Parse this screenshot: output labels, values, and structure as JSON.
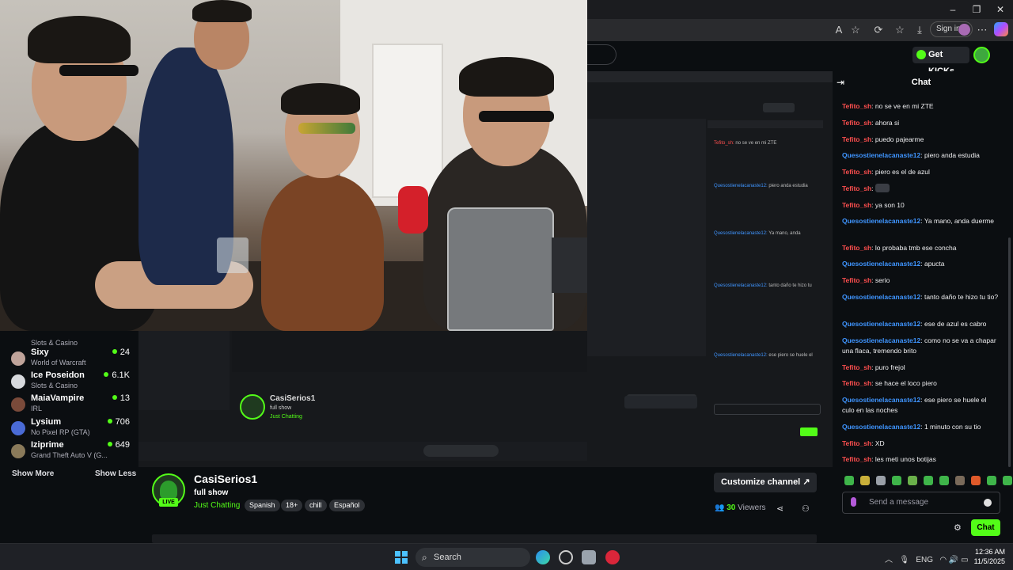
{
  "browser": {
    "signin_label": "Sign in",
    "window_controls": [
      "–",
      "❐",
      "✕"
    ],
    "toolbar_icons": [
      "read-aloud-icon",
      "favorite-star-icon",
      "extensions-icon",
      "favorites-icon",
      "downloads-icon"
    ]
  },
  "header": {
    "get_kicks_label": "Get KICKs"
  },
  "sidebar": {
    "partial_top": {
      "name": "",
      "category": "Slots & Casino"
    },
    "items": [
      {
        "name": "Sixy",
        "category": "World of Warcraft",
        "viewers": "24",
        "avatar_color": "#bfa39a"
      },
      {
        "name": "Ice Poseidon",
        "category": "Slots & Casino",
        "viewers": "6.1K",
        "avatar_color": "#d7d9dd"
      },
      {
        "name": "MaiaVampire",
        "category": "IRL",
        "viewers": "13",
        "avatar_color": "#7a4a3a"
      },
      {
        "name": "Lysium",
        "category": "No Pixel RP (GTA)",
        "viewers": "706",
        "avatar_color": "#4a6bd6"
      },
      {
        "name": "Iziprime",
        "category": "Grand Theft Auto V (G...",
        "viewers": "649",
        "avatar_color": "#8a7a5a"
      }
    ],
    "show_more": "Show More",
    "show_less": "Show Less"
  },
  "channel": {
    "name": "CasiSerios1",
    "live_badge": "LIVE",
    "title": "full show",
    "category": "Just Chatting",
    "tags": [
      "Spanish",
      "18+",
      "chill",
      "Español"
    ],
    "customize_label": "Customize channel",
    "viewers_count": "30",
    "viewers_label": "Viewers"
  },
  "chat": {
    "title": "Chat",
    "messages": [
      {
        "user": "Tefito_sh",
        "color": "red",
        "text": "no se ve en mi ZTE"
      },
      {
        "user": "Tefito_sh",
        "color": "red",
        "text": "ahora si"
      },
      {
        "user": "Tefito_sh",
        "color": "red",
        "text": "puedo pajearme"
      },
      {
        "user": "Quesostienelacanaste12",
        "color": "blue",
        "text": "piero anda estudia"
      },
      {
        "user": "Tefito_sh",
        "color": "red",
        "text": "piero es el de azul"
      },
      {
        "user": "Tefito_sh",
        "color": "red",
        "text": ""
      },
      {
        "user": "Tefito_sh",
        "color": "red",
        "text": "ya son 10"
      },
      {
        "user": "Quesostienelacanaste12",
        "color": "blue",
        "text": "Ya mano, anda duerme"
      },
      {
        "user": "Tefito_sh",
        "color": "red",
        "text": "lo probaba tmb ese concha"
      },
      {
        "user": "Quesostienelacanaste12",
        "color": "blue",
        "text": "apucta"
      },
      {
        "user": "Tefito_sh",
        "color": "red",
        "text": "serio"
      },
      {
        "user": "Quesostienelacanaste12",
        "color": "blue",
        "text": "tanto daño te hizo tu tio?"
      },
      {
        "user": "Quesostienelacanaste12",
        "color": "blue",
        "text": "ese de azul es cabro"
      },
      {
        "user": "Quesostienelacanaste12",
        "color": "blue",
        "text": "como no se va a chapar una flaca, tremendo brito"
      },
      {
        "user": "Tefito_sh",
        "color": "red",
        "text": "puro frejol"
      },
      {
        "user": "Tefito_sh",
        "color": "red",
        "text": "se hace el loco piero"
      },
      {
        "user": "Quesostienelacanaste12",
        "color": "blue",
        "text": "ese piero se huele el culo en las noches"
      },
      {
        "user": "Quesostienelacanaste12",
        "color": "blue",
        "text": "1 minuto con su tio"
      },
      {
        "user": "Tefito_sh",
        "color": "red",
        "text": "XD"
      },
      {
        "user": "Tefito_sh",
        "color": "red",
        "text": "les meti unos botijas"
      }
    ],
    "input_placeholder": "Send a message",
    "send_label": "Chat"
  },
  "taskbar": {
    "search_label": "Search",
    "language": "ENG",
    "time": "12:36 AM",
    "date": "11/5/2025"
  },
  "colors": {
    "kick_green": "#53fc18",
    "user_red": "#ff4f4f",
    "user_blue": "#3f95ff",
    "background": "#0b0e11"
  }
}
